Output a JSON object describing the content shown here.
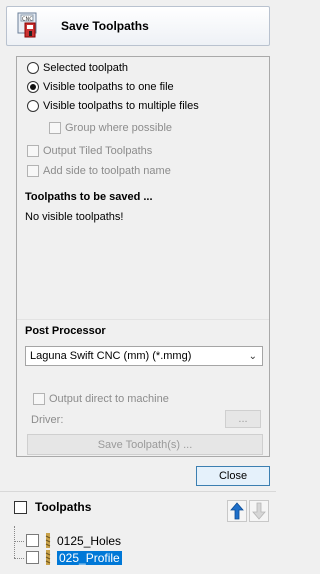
{
  "header": {
    "title": "Save Toolpaths"
  },
  "options": {
    "selected_toolpath": "Selected toolpath",
    "visible_one_file": "Visible toolpaths to one file",
    "visible_multiple_files": "Visible toolpaths to multiple files",
    "group_where_possible": "Group where possible",
    "output_tiled": "Output Tiled Toolpaths",
    "add_side": "Add side to toolpath name",
    "selected_radio": "visible_one_file"
  },
  "saved_section": {
    "title": "Toolpaths to be saved ...",
    "empty_message": "No visible toolpaths!"
  },
  "post_processor": {
    "title": "Post Processor",
    "selected": "Laguna Swift CNC (mm) (*.mmg)"
  },
  "machine": {
    "output_direct": "Output direct to machine",
    "driver_label": "Driver:",
    "browse_label": "...",
    "save_label": "Save Toolpath(s) ..."
  },
  "close_label": "Close",
  "toolpaths_panel": {
    "title": "Toolpaths",
    "items": [
      {
        "name": "0125_Holes",
        "selected": false
      },
      {
        "name": "025_Profile",
        "selected": true
      }
    ]
  },
  "colors": {
    "accent": "#0078d7",
    "arrow": "#1e6fc9"
  }
}
